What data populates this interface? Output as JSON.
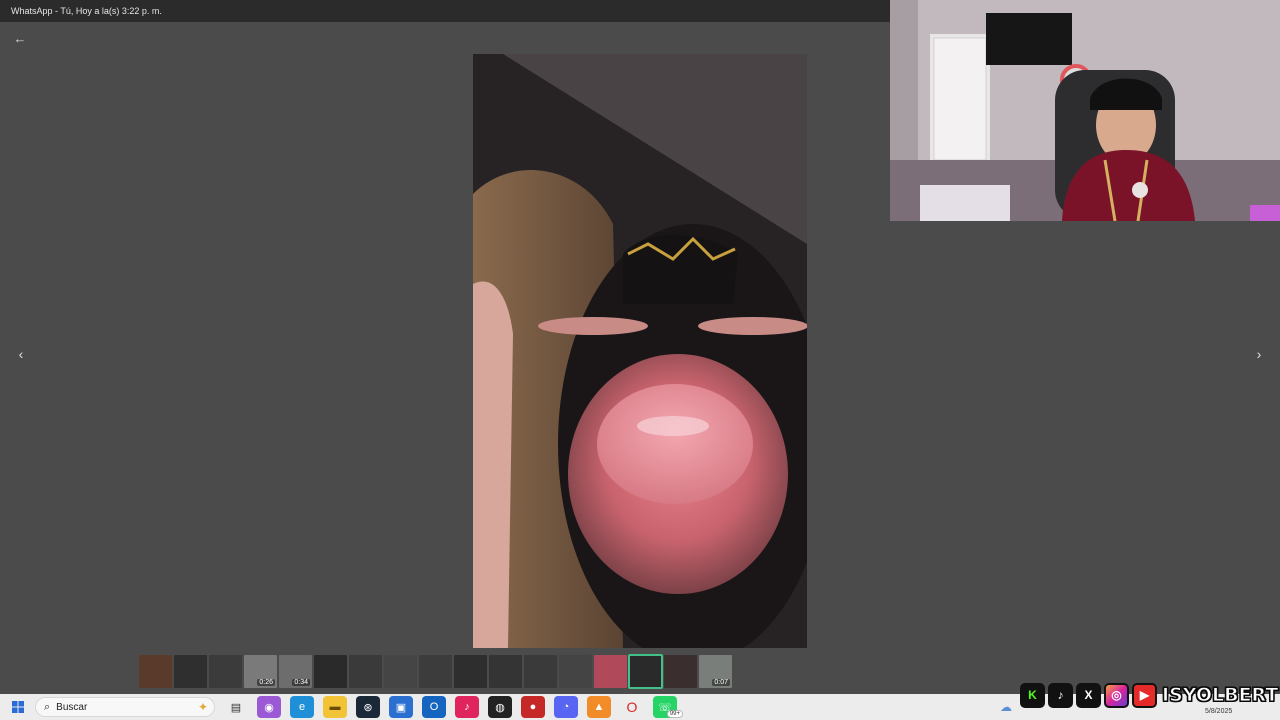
{
  "window": {
    "title": "WhatsApp - Tú, Hoy a la(s) 3:22 p. m."
  },
  "viewer": {
    "back_icon": "←",
    "prev_icon": "‹",
    "next_icon": "›"
  },
  "thumbnails": [
    {
      "duration": ""
    },
    {
      "duration": ""
    },
    {
      "duration": ""
    },
    {
      "duration": "0:26"
    },
    {
      "duration": "0:34"
    },
    {
      "duration": ""
    },
    {
      "duration": ""
    },
    {
      "duration": ""
    },
    {
      "duration": ""
    },
    {
      "duration": ""
    },
    {
      "duration": ""
    },
    {
      "duration": ""
    },
    {
      "duration": ""
    },
    {
      "duration": ""
    },
    {
      "duration": "",
      "active": true
    },
    {
      "duration": ""
    },
    {
      "duration": "0:07"
    }
  ],
  "taskbar": {
    "search_placeholder": "Buscar",
    "notification_badge": "99+",
    "date": "5/8/2025"
  },
  "overlay": {
    "channel_name": "ISYOLBERT",
    "icons": [
      "kick-icon",
      "tiktok-icon",
      "x-icon",
      "instagram-icon",
      "youtube-icon"
    ]
  },
  "colors": {
    "whatsapp_green": "#41c08a",
    "kick_green": "#53fc18",
    "youtube_red": "#e52a2a"
  }
}
